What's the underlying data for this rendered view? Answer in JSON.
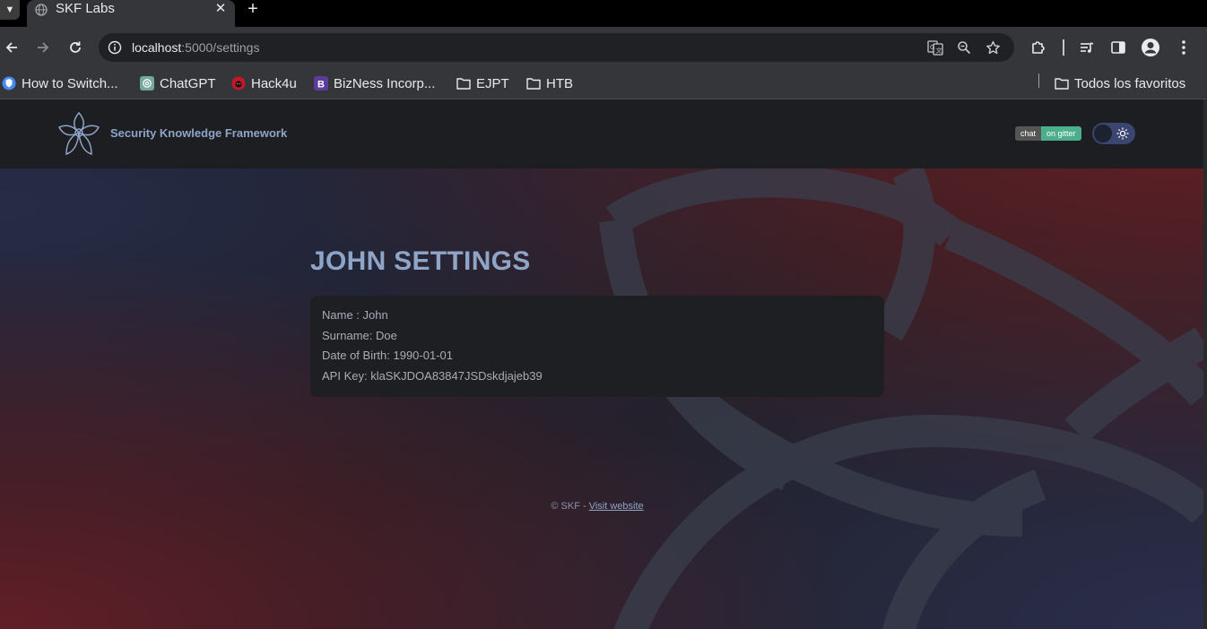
{
  "browser": {
    "tab_title": "SKF Labs",
    "url_host": "localhost",
    "url_path": ":5000/settings",
    "bookmarks": [
      {
        "label": "How to Switch...",
        "icon": "shield-icon"
      },
      {
        "label": "ChatGPT",
        "icon": "chatgpt-icon"
      },
      {
        "label": "Hack4u",
        "icon": "hack4u-icon"
      },
      {
        "label": "BizNess Incorp...",
        "icon": "bootstrap-icon"
      },
      {
        "label": "EJPT",
        "icon": "folder-icon"
      },
      {
        "label": "HTB",
        "icon": "folder-icon"
      }
    ],
    "all_bookmarks_label": "Todos los favoritos"
  },
  "header": {
    "brand": "Security Knowledge Framework",
    "badge_left": "chat",
    "badge_right": "on gitter"
  },
  "main": {
    "title": "JOHN SETTINGS",
    "fields": [
      "Name : John",
      "Surname: Doe",
      "Date of Birth: 1990-01-01",
      "API Key: klaSKJDOA83847JSDskdjajeb39"
    ]
  },
  "footer": {
    "prefix": "© SKF - ",
    "link": "Visit website"
  },
  "colors": {
    "accent": "#8fa5c7",
    "gitter_green": "#4cae8c",
    "header_bg": "#1d1e22"
  }
}
